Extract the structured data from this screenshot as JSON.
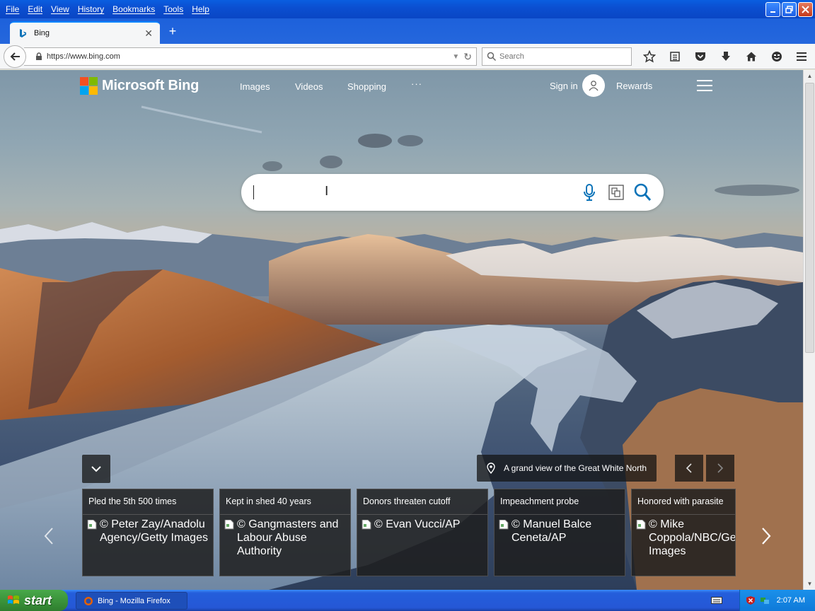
{
  "window": {
    "menu": [
      "File",
      "Edit",
      "View",
      "History",
      "Bookmarks",
      "Tools",
      "Help"
    ],
    "buttons": [
      "minimize",
      "restore",
      "close"
    ]
  },
  "browser": {
    "tab_title": "Bing",
    "url": "https://www.bing.com",
    "search_placeholder": "Search",
    "toolbar_icons": [
      "bookmark-star-icon",
      "reading-list-icon",
      "pocket-icon",
      "download-icon",
      "home-icon",
      "smiley-icon"
    ]
  },
  "bing": {
    "brand": "Microsoft Bing",
    "nav": [
      "Images",
      "Videos",
      "Shopping",
      "···"
    ],
    "sign_in": "Sign in",
    "rewards": "Rewards",
    "location_caption": "A grand view of the Great White North",
    "cards": [
      {
        "headline": "Pled the 5th 500 times",
        "credit": "© Peter Zay/Anadolu Agency/Getty Images"
      },
      {
        "headline": "Kept in shed 40 years",
        "credit": "© Gangmasters and Labour Abuse Authority"
      },
      {
        "headline": "Donors threaten cutoff",
        "credit": "© Evan Vucci/AP"
      },
      {
        "headline": "Impeachment probe",
        "credit": "© Manuel Balce Ceneta/AP"
      },
      {
        "headline": "Honored with parasite",
        "credit": "© Mike Coppola/NBC/Getty Images"
      }
    ],
    "logo_colors": [
      "#f25022",
      "#7fba00",
      "#00a4ef",
      "#ffb900"
    ],
    "accent": "#0c73b8"
  },
  "taskbar": {
    "start": "start",
    "task_label": "Bing - Mozilla Firefox",
    "clock": "2:07 AM"
  }
}
